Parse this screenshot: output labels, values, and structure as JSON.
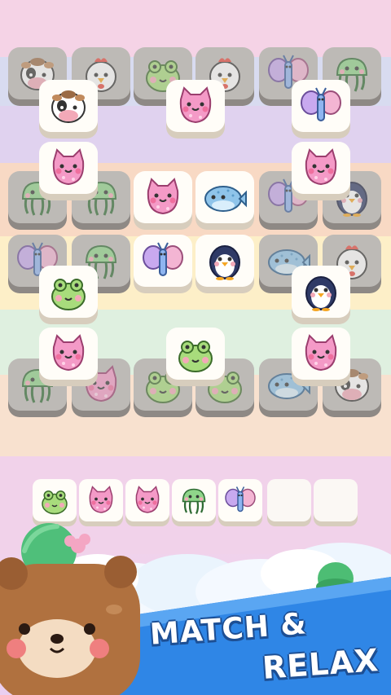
{
  "banner": {
    "line1": "MATCH &",
    "line2": "RELAX"
  },
  "colors": {
    "banner_blue": "#1d6fd1",
    "tile_face": "#fffdf8",
    "tile_dim": "#bdbab6"
  },
  "board": {
    "tiles": [
      {
        "icon": "cow-icon",
        "state": "covered"
      },
      {
        "icon": "chicken-icon",
        "state": "covered"
      },
      {
        "icon": "frog-icon",
        "state": "covered"
      },
      {
        "icon": "chicken-icon",
        "state": "covered"
      },
      {
        "icon": "butterfly-icon",
        "state": "covered"
      },
      {
        "icon": "jellyfish-icon",
        "state": "covered"
      },
      {
        "icon": "cow-icon",
        "state": "open"
      },
      {
        "icon": "pink-cat-icon",
        "state": "open"
      },
      {
        "icon": "butterfly-icon",
        "state": "open"
      },
      {
        "icon": "pink-cat-icon",
        "state": "open"
      },
      {
        "icon": "pink-cat-icon",
        "state": "open"
      },
      {
        "icon": "jellyfish-icon",
        "state": "covered"
      },
      {
        "icon": "jellyfish-icon",
        "state": "covered"
      },
      {
        "icon": "pink-cat-icon",
        "state": "open"
      },
      {
        "icon": "whale-icon",
        "state": "open"
      },
      {
        "icon": "butterfly-icon",
        "state": "covered"
      },
      {
        "icon": "penguin-icon",
        "state": "covered"
      },
      {
        "icon": "butterfly-icon",
        "state": "covered"
      },
      {
        "icon": "jellyfish-icon",
        "state": "covered"
      },
      {
        "icon": "butterfly-icon",
        "state": "open"
      },
      {
        "icon": "penguin-icon",
        "state": "open"
      },
      {
        "icon": "whale-icon",
        "state": "covered"
      },
      {
        "icon": "chicken-icon",
        "state": "covered"
      },
      {
        "icon": "frog-icon",
        "state": "open"
      },
      {
        "icon": "penguin-icon",
        "state": "open"
      },
      {
        "icon": "jellyfish-icon",
        "state": "covered"
      },
      {
        "icon": "pink-cat-icon",
        "state": "covered"
      },
      {
        "icon": "frog-icon",
        "state": "covered"
      },
      {
        "icon": "frog-icon",
        "state": "covered"
      },
      {
        "icon": "whale-icon",
        "state": "covered"
      },
      {
        "icon": "cow-icon",
        "state": "covered"
      },
      {
        "icon": "pink-cat-icon",
        "state": "open"
      },
      {
        "icon": "frog-icon",
        "state": "open"
      },
      {
        "icon": "pink-cat-icon",
        "state": "open"
      }
    ]
  },
  "tray": {
    "slots": [
      {
        "icon": "frog-icon"
      },
      {
        "icon": "pink-cat-icon"
      },
      {
        "icon": "pink-cat-icon"
      },
      {
        "icon": "jellyfish-icon"
      },
      {
        "icon": "butterfly-icon"
      },
      {
        "icon": ""
      },
      {
        "icon": ""
      }
    ]
  },
  "mascot": {
    "icon": "bear-mascot-icon"
  }
}
